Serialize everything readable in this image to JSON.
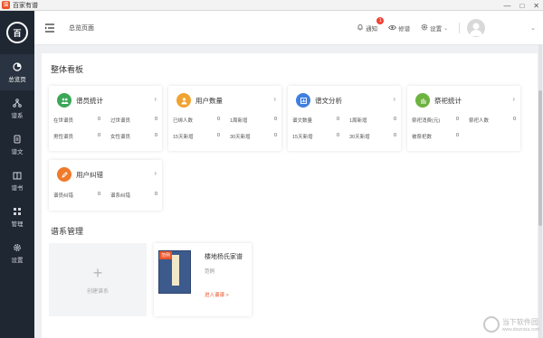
{
  "window": {
    "title": "百家有谱",
    "app_icon_glyph": "谱"
  },
  "sidebar": {
    "logo_text": "百",
    "items": [
      {
        "label": "总览页",
        "icon": "pie-chart-icon",
        "active": true
      },
      {
        "label": "谱系",
        "icon": "tree-icon",
        "active": false
      },
      {
        "label": "谱文",
        "icon": "document-icon",
        "active": false
      },
      {
        "label": "谱书",
        "icon": "book-icon",
        "active": false
      },
      {
        "label": "管理",
        "icon": "grid-icon",
        "active": false
      },
      {
        "label": "设置",
        "icon": "gear-icon",
        "active": false
      }
    ]
  },
  "header": {
    "breadcrumb": "总览页面",
    "notifications_label": "通知",
    "notifications_count": "1",
    "edit_label": "修谱",
    "settings_label": "设置"
  },
  "dashboard": {
    "title": "整体看板",
    "cards": [
      {
        "title": "谱员统计",
        "icon": "people-icon",
        "color": "#3aa757",
        "stats": [
          [
            "在世谱员",
            "0"
          ],
          [
            "过世谱员",
            "0"
          ],
          [
            "男性谱员",
            "0"
          ],
          [
            "女性谱员",
            "0"
          ]
        ]
      },
      {
        "title": "用户数量",
        "icon": "user-icon",
        "color": "#f0a330",
        "stats": [
          [
            "已绑人数",
            "0"
          ],
          [
            "1周新增",
            "0"
          ],
          [
            "15天新增",
            "0"
          ],
          [
            "30天新增",
            "0"
          ]
        ]
      },
      {
        "title": "谱文分析",
        "icon": "chart-icon",
        "color": "#3f7fe0",
        "stats": [
          [
            "谱文数量",
            "0"
          ],
          [
            "1周新增",
            "0"
          ],
          [
            "15天新增",
            "0"
          ],
          [
            "30天新增",
            "0"
          ]
        ]
      },
      {
        "title": "祭祀统计",
        "icon": "leaf-icon",
        "color": "#6cb33f",
        "stats": [
          [
            "祭祀消费(元)",
            "0"
          ],
          [
            "祭祀人数",
            "0"
          ],
          [
            "被祭祀数",
            "0"
          ]
        ]
      },
      {
        "title": "用户纠错",
        "icon": "pencil-icon",
        "color": "#ef7a2a",
        "stats": [
          [
            "谱员纠错",
            "0"
          ],
          [
            "谱系纠错",
            "0"
          ]
        ]
      }
    ]
  },
  "lineage": {
    "title": "谱系管理",
    "create_label": "创建谱系",
    "book": {
      "title": "楼地杨氏家谱",
      "subtitle": "范例",
      "enter_label": "进入谱谱 >",
      "tag": "范例"
    }
  },
  "watermark": {
    "text": "当下软件园",
    "url": "www.downxia.com"
  }
}
